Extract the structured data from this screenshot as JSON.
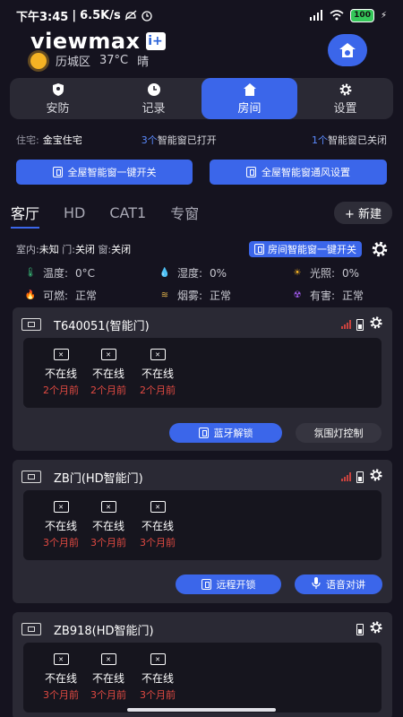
{
  "status": {
    "time": "下午3:45",
    "speed": "6.5K/s",
    "battery": "100"
  },
  "brand": {
    "logo": "viewmax",
    "plus": "i+"
  },
  "weather": {
    "location": "历城区",
    "temp": "37°C",
    "cond": "晴"
  },
  "nav_tabs": [
    {
      "label": "安防",
      "icon": "shield-icon"
    },
    {
      "label": "记录",
      "icon": "clock-icon"
    },
    {
      "label": "房间",
      "icon": "home-icon"
    },
    {
      "label": "设置",
      "icon": "gear-icon"
    }
  ],
  "summary": {
    "house_label": "住宅:",
    "house_name": "金宝住宅",
    "open_count": "3个",
    "open_text": "智能窗已打开",
    "closed_count": "1个",
    "closed_text": "智能窗已关闭"
  },
  "buttons": {
    "all_switch": "全屋智能窗一键开关",
    "all_vent": "全屋智能窗通风设置"
  },
  "rooms": [
    "客厅",
    "HD",
    "CAT1",
    "专窗"
  ],
  "new_label": "+ 新建",
  "room_state": {
    "indoor_label": "室内:",
    "indoor_val": "未知",
    "door_label": "门:",
    "door_val": "关闭",
    "window_label": "窗:",
    "window_val": "关闭",
    "room_switch": "房间智能窗一键开关"
  },
  "sensors": [
    {
      "label": "温度:",
      "value": "0°C",
      "icon": "thermometer-icon",
      "color": "#39c07a"
    },
    {
      "label": "湿度:",
      "value": "0%",
      "icon": "droplet-icon",
      "color": "#4a8cff"
    },
    {
      "label": "光照:",
      "value": "0%",
      "icon": "sun-icon",
      "color": "#f5b324"
    },
    {
      "label": "可燃:",
      "value": "正常",
      "icon": "flame-icon",
      "color": "#4a8cff"
    },
    {
      "label": "烟雾:",
      "value": "正常",
      "icon": "smoke-icon",
      "color": "#e0b24a"
    },
    {
      "label": "有害:",
      "value": "正常",
      "icon": "hazard-icon",
      "color": "#a35cf0"
    }
  ],
  "devices": [
    {
      "title": "T640051(智能门)",
      "windows": [
        {
          "status": "不在线",
          "time": "2个月前"
        },
        {
          "status": "不在线",
          "time": "2个月前"
        },
        {
          "status": "不在线",
          "time": "2个月前"
        }
      ],
      "actions": [
        {
          "label": "蓝牙解锁",
          "style": "blue",
          "icon": "window-icon"
        },
        {
          "label": "氛围灯控制",
          "style": "dark",
          "icon": ""
        }
      ]
    },
    {
      "title": "ZB门(HD智能门)",
      "windows": [
        {
          "status": "不在线",
          "time": "3个月前"
        },
        {
          "status": "不在线",
          "time": "3个月前"
        },
        {
          "status": "不在线",
          "time": "3个月前"
        }
      ],
      "actions": [
        {
          "label": "远程开锁",
          "style": "blue",
          "icon": "window-icon"
        },
        {
          "label": "语音对讲",
          "style": "blue",
          "icon": "microphone-icon"
        }
      ]
    },
    {
      "title": "ZB918(HD智能门)",
      "windows": [
        {
          "status": "不在线",
          "time": "3个月前"
        },
        {
          "status": "不在线",
          "time": "3个月前"
        },
        {
          "status": "不在线",
          "time": "3个月前"
        }
      ],
      "actions": []
    }
  ]
}
